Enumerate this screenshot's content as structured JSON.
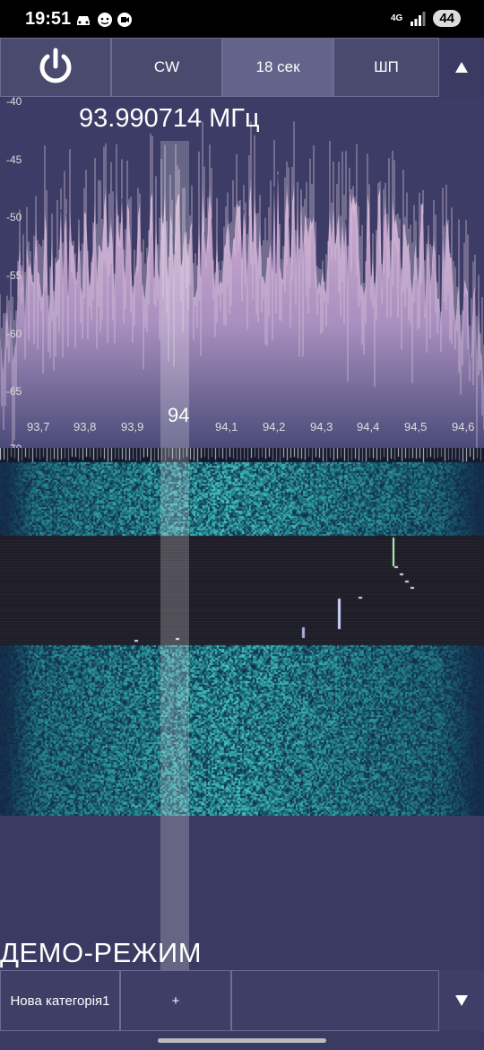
{
  "status_bar": {
    "time": "19:51",
    "icons": [
      "car-icon",
      "face-icon",
      "cast-icon"
    ],
    "network": "4G",
    "battery": "44"
  },
  "toolbar": {
    "power_icon": "power-icon",
    "mode": "CW",
    "time_span": "18 сек",
    "filter": "ШП",
    "collapse_icon": "triangle-up-icon"
  },
  "spectrum": {
    "frequency": "93.990714 МГц",
    "y_ticks": [
      "-40",
      "-45",
      "-50",
      "-55",
      "-60",
      "-65",
      "-70"
    ],
    "x_ticks": [
      "93,7",
      "93,8",
      "93,9",
      "94,1",
      "94,2",
      "94,3",
      "94,4",
      "94,5",
      "94,6"
    ],
    "x_cursor_label": "94"
  },
  "chart_data": {
    "type": "line",
    "title": "93.990714 МГц",
    "xlabel": "",
    "ylabel": "",
    "xlim": [
      93.63,
      94.65
    ],
    "ylim": [
      -70,
      -40
    ],
    "x_ticks": [
      93.7,
      93.8,
      93.9,
      94.0,
      94.1,
      94.2,
      94.3,
      94.4,
      94.5,
      94.6
    ],
    "y_ticks": [
      -40,
      -45,
      -50,
      -55,
      -60,
      -65,
      -70
    ],
    "cursor_x": 93.990714,
    "grid": false,
    "legend": "none",
    "envelope": {
      "x": [
        93.63,
        93.7,
        93.8,
        93.9,
        94.0,
        94.1,
        94.2,
        94.3,
        94.4,
        94.5,
        94.6,
        94.65
      ],
      "y": [
        -60,
        -55,
        -52,
        -53,
        -52,
        -52,
        -51,
        -53,
        -52,
        -53,
        -56,
        -62
      ]
    }
  },
  "colors": {
    "background": "#3b3a62",
    "spectrum_fill": "#c7a4c8",
    "waterfall_noise": "#2e8fb0",
    "band_dark": "#1e1d2c"
  },
  "footer": {
    "demo_label": "ДЕМО-РЕЖИМ",
    "category": "Нова категорія1",
    "add_label": "+",
    "expand_icon": "triangle-down-icon"
  }
}
